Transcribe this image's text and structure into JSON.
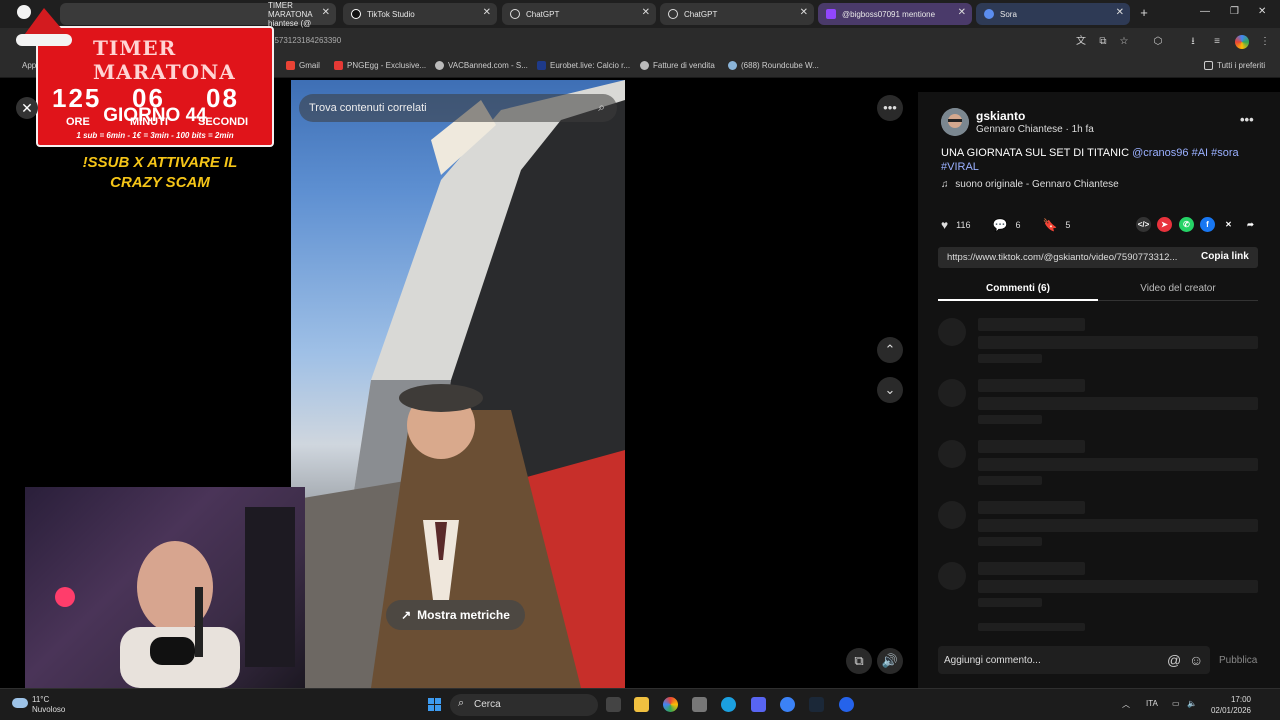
{
  "browser": {
    "tabs": [
      {
        "label": "TIMER MARATONA hiantese (@",
        "kind": "tiktok"
      },
      {
        "label": "TikTok Studio",
        "kind": "tiktok"
      },
      {
        "label": "ChatGPT",
        "kind": "chatgpt"
      },
      {
        "label": "ChatGPT",
        "kind": "chatgpt"
      },
      {
        "label": "@bigboss07091 mentione",
        "kind": "twitch"
      },
      {
        "label": "Sora",
        "kind": "sora"
      }
    ],
    "url_fragment": "7573123184263390",
    "bookmarks": [
      "App",
      "Gmail",
      "PNGEgg - Exclusive...",
      "VACBanned.com - S...",
      "Eurobet.live: Calcio r...",
      "Fatture di vendita",
      "(688) Roundcube W..."
    ],
    "all_bookmarks": "Tutti i preferiti"
  },
  "overlay": {
    "timer_title": "TIMER MARATONA",
    "hours": "125",
    "minutes": "06",
    "seconds": "08",
    "hours_label": "ORE",
    "minutes_label": "MINUTI",
    "seconds_label": "SECONDI",
    "day": "GIORNO 44",
    "rates": "1 sub = 6min - 1€ = 3min - 100 bits = 2min",
    "sub_msg": "!SSUB X ATTIVARE IL CRAZY SCAM"
  },
  "video": {
    "search_placeholder": "Trova contenuti correlati",
    "metrics_label": "Mostra metriche"
  },
  "post": {
    "username": "gskianto",
    "display_name": "Gennaro Chiantese · 1h fa",
    "caption_text": "UNA GIORNATA SUL SET DI TITANIC ",
    "caption_tags": "@cranos96 #AI #sora #VIRAL",
    "sound": "suono originale - Gennaro Chiantese",
    "likes": "116",
    "comments": "6",
    "saves": "5",
    "link": "https://www.tiktok.com/@gskianto/video/7590773312...",
    "copy_link": "Copia link",
    "tab_comments": "Commenti (6)",
    "tab_creator": "Video del creator",
    "comment_placeholder": "Aggiungi commento...",
    "publish": "Pubblica"
  },
  "taskbar": {
    "temp": "11°C",
    "weather": "Nuvoloso",
    "search": "Cerca",
    "lang": "ITA",
    "time": "17:00",
    "date": "02/01/2026"
  },
  "colors": {
    "timer_red": "#e0141a",
    "accent_yellow": "#f5c518",
    "tag_blue": "#9ab0ff"
  }
}
